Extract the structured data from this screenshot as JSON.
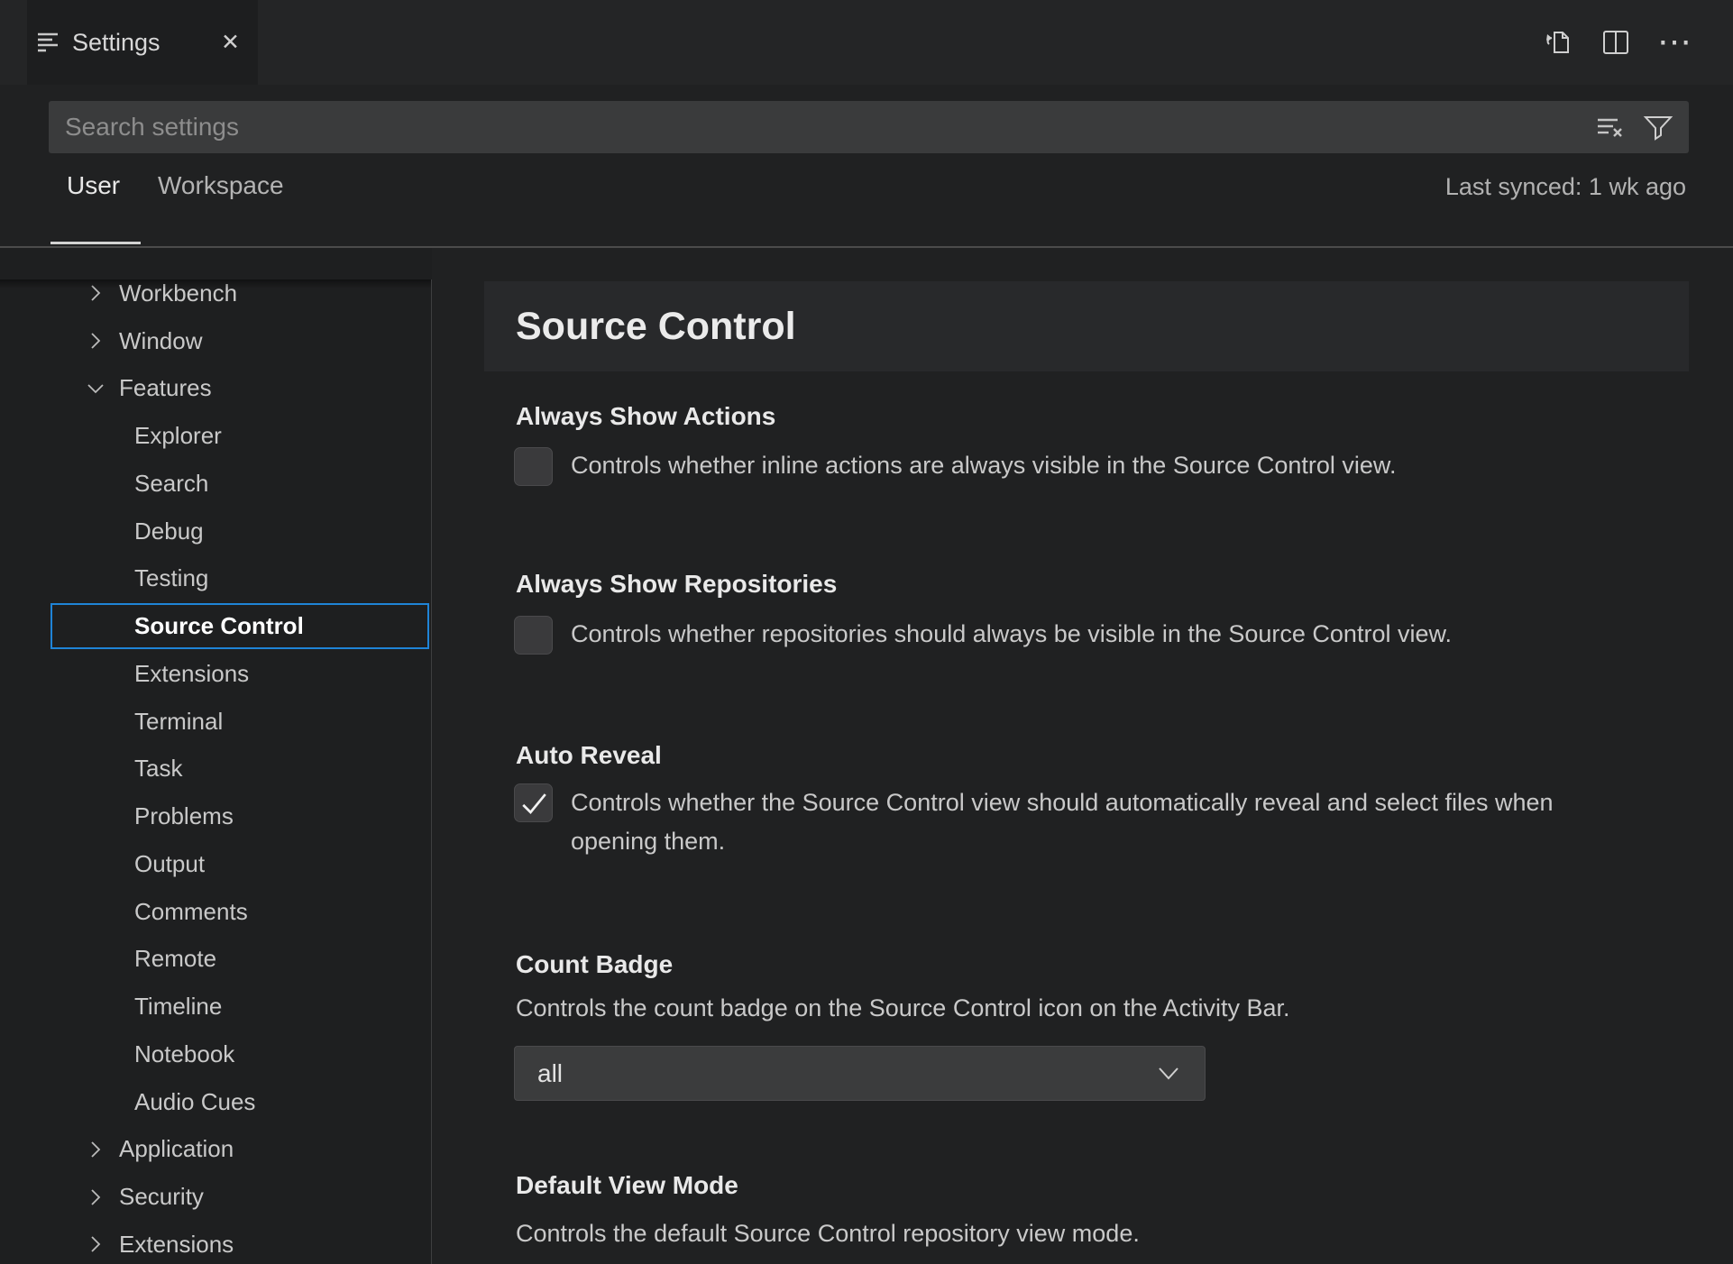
{
  "window": {
    "tab_title": "Settings"
  },
  "toolbar": {
    "icons": [
      "open-settings-json",
      "split-editor",
      "more-actions"
    ]
  },
  "search": {
    "placeholder": "Search settings",
    "value": ""
  },
  "scope_tabs": {
    "user": "User",
    "workspace": "Workspace",
    "active": "User",
    "last_synced": "Last synced: 1 wk ago"
  },
  "sidebar": {
    "items": [
      {
        "label": "Workbench",
        "level": "root",
        "chevron": "right",
        "selected": false
      },
      {
        "label": "Window",
        "level": "root",
        "chevron": "right",
        "selected": false
      },
      {
        "label": "Features",
        "level": "root",
        "chevron": "down",
        "selected": false
      },
      {
        "label": "Explorer",
        "level": "child",
        "chevron": null,
        "selected": false
      },
      {
        "label": "Search",
        "level": "child",
        "chevron": null,
        "selected": false
      },
      {
        "label": "Debug",
        "level": "child",
        "chevron": null,
        "selected": false
      },
      {
        "label": "Testing",
        "level": "child",
        "chevron": null,
        "selected": false
      },
      {
        "label": "Source Control",
        "level": "child",
        "chevron": null,
        "selected": true
      },
      {
        "label": "Extensions",
        "level": "child",
        "chevron": null,
        "selected": false
      },
      {
        "label": "Terminal",
        "level": "child",
        "chevron": null,
        "selected": false
      },
      {
        "label": "Task",
        "level": "child",
        "chevron": null,
        "selected": false
      },
      {
        "label": "Problems",
        "level": "child",
        "chevron": null,
        "selected": false
      },
      {
        "label": "Output",
        "level": "child",
        "chevron": null,
        "selected": false
      },
      {
        "label": "Comments",
        "level": "child",
        "chevron": null,
        "selected": false
      },
      {
        "label": "Remote",
        "level": "child",
        "chevron": null,
        "selected": false
      },
      {
        "label": "Timeline",
        "level": "child",
        "chevron": null,
        "selected": false
      },
      {
        "label": "Notebook",
        "level": "child",
        "chevron": null,
        "selected": false
      },
      {
        "label": "Audio Cues",
        "level": "child",
        "chevron": null,
        "selected": false
      },
      {
        "label": "Application",
        "level": "root",
        "chevron": "right",
        "selected": false
      },
      {
        "label": "Security",
        "level": "root",
        "chevron": "right",
        "selected": false
      },
      {
        "label": "Extensions",
        "level": "root",
        "chevron": "right",
        "selected": false
      }
    ]
  },
  "main": {
    "title": "Source Control",
    "settings": [
      {
        "label": "Always Show Actions",
        "type": "checkbox",
        "checked": false,
        "description": "Controls whether inline actions are always visible in the Source Control view."
      },
      {
        "label": "Always Show Repositories",
        "type": "checkbox",
        "checked": false,
        "description": "Controls whether repositories should always be visible in the Source Control view."
      },
      {
        "label": "Auto Reveal",
        "type": "checkbox",
        "checked": true,
        "description": "Controls whether the Source Control view should automatically reveal and select files when opening them."
      },
      {
        "label": "Count Badge",
        "type": "select",
        "value": "all",
        "description": "Controls the count badge on the Source Control icon on the Activity Bar."
      },
      {
        "label": "Default View Mode",
        "type": "select",
        "value": "",
        "description": "Controls the default Source Control repository view mode."
      }
    ]
  },
  "icons": {
    "settings_tab": "list-lines",
    "close": "✕",
    "open_settings_json": "file-with-arrow",
    "split_editor": "split-rect",
    "more_actions": "⋯",
    "clear_search": "lines-with-x",
    "filter": "funnel",
    "chevron_right": "›",
    "chevron_down": "⌄",
    "check": "✓",
    "select_chevron": "⌄"
  },
  "colors": {
    "accent_border": "#1f84d7",
    "background": "#202122",
    "tabstrip": "#242526",
    "heading_band": "#28292b",
    "input_background": "#3a3b3c",
    "text": "#c9c9c9",
    "text_bright": "#e9e9e9"
  }
}
